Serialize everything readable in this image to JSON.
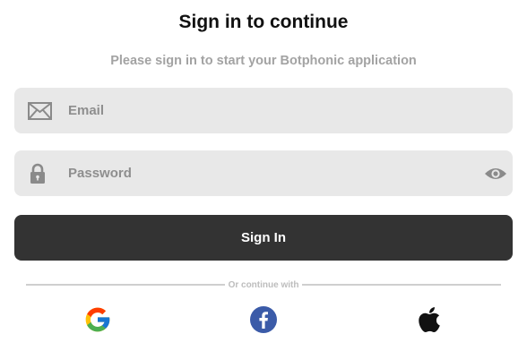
{
  "header": {
    "title": "Sign in to continue",
    "subtitle": "Please sign in to start your Botphonic application"
  },
  "form": {
    "email": {
      "placeholder": "Email",
      "value": "",
      "icon": "envelope-icon"
    },
    "password": {
      "placeholder": "Password",
      "value": "",
      "icon": "lock-icon",
      "toggle_icon": "eye-icon"
    },
    "submit_label": "Sign In"
  },
  "divider": {
    "text": "Or continue with"
  },
  "social": [
    {
      "provider": "Google",
      "icon": "google-icon"
    },
    {
      "provider": "Facebook",
      "icon": "facebook-icon"
    },
    {
      "provider": "Apple",
      "icon": "apple-icon"
    }
  ],
  "colors": {
    "field_background": "#e8e8e8",
    "button_background": "#333333",
    "button_text": "#ffffff",
    "subtitle": "#a3a3a3",
    "icon": "#8a8a8a",
    "facebook": "#3b5ba8"
  }
}
